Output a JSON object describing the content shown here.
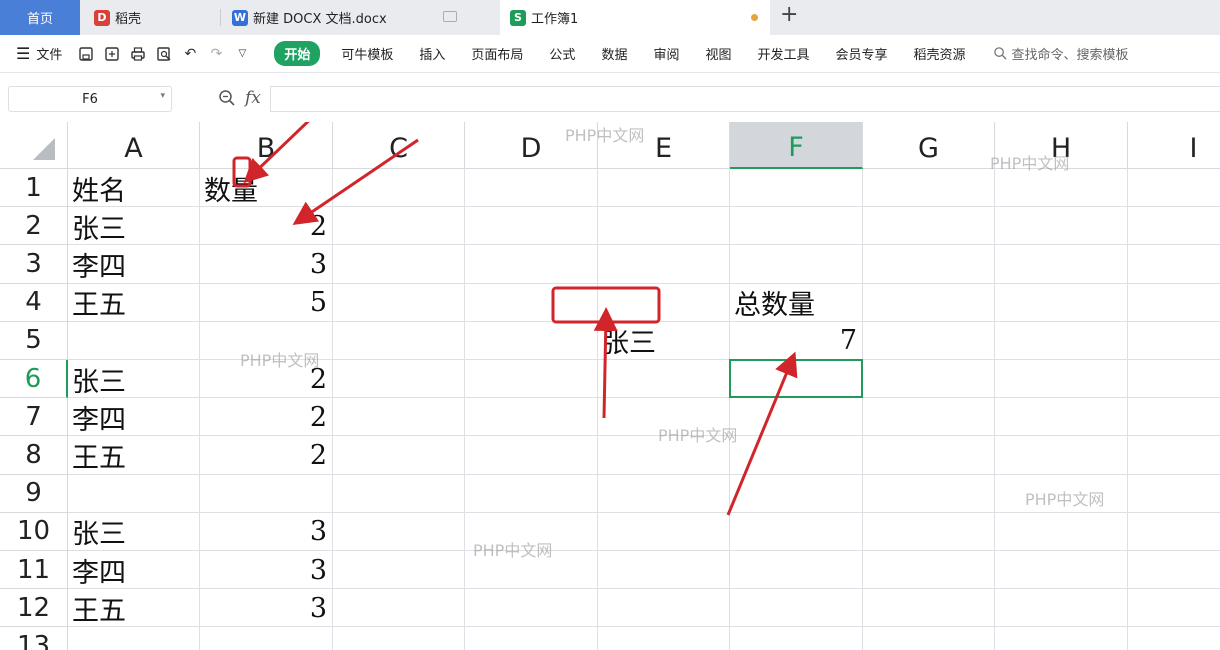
{
  "tabs": {
    "home": "首页",
    "daoke": "稻壳",
    "doc": "新建 DOCX 文档.docx",
    "sheet": "工作簿1"
  },
  "menubar": {
    "file": "文件",
    "items": [
      "开始",
      "可牛模板",
      "插入",
      "页面布局",
      "公式",
      "数据",
      "审阅",
      "视图",
      "开发工具",
      "会员专享",
      "稻壳资源"
    ],
    "active_item": "开始",
    "search_placeholder": "查找命令、搜索模板"
  },
  "formula_bar": {
    "name_box": "F6",
    "fx_label": "fx",
    "value": ""
  },
  "columns": [
    "A",
    "B",
    "C",
    "D",
    "E",
    "F",
    "G",
    "H",
    "I"
  ],
  "selected_column": "F",
  "rows": [
    "1",
    "2",
    "3",
    "4",
    "5",
    "6",
    "7",
    "8",
    "9",
    "10",
    "11",
    "12",
    "13"
  ],
  "selected_row": "6",
  "cells": {
    "A1": "姓名",
    "B1": "数量",
    "A2": "张三",
    "B2": "2",
    "A3": "李四",
    "B3": "3",
    "A4": "王五",
    "B4": "5",
    "A6": "张三",
    "B6": "2",
    "A7": "李四",
    "B7": "2",
    "A8": "王五",
    "B8": "2",
    "A10": "张三",
    "B10": "3",
    "A11": "李四",
    "B11": "3",
    "A12": "王五",
    "B12": "3",
    "F4": "总数量",
    "E5": "张三",
    "F5": "7"
  },
  "watermark": "PHP中文网",
  "colors": {
    "accent_green": "#1f9b5a",
    "home_tab_blue": "#4a7fd8",
    "annotation_red": "#d0262b"
  }
}
